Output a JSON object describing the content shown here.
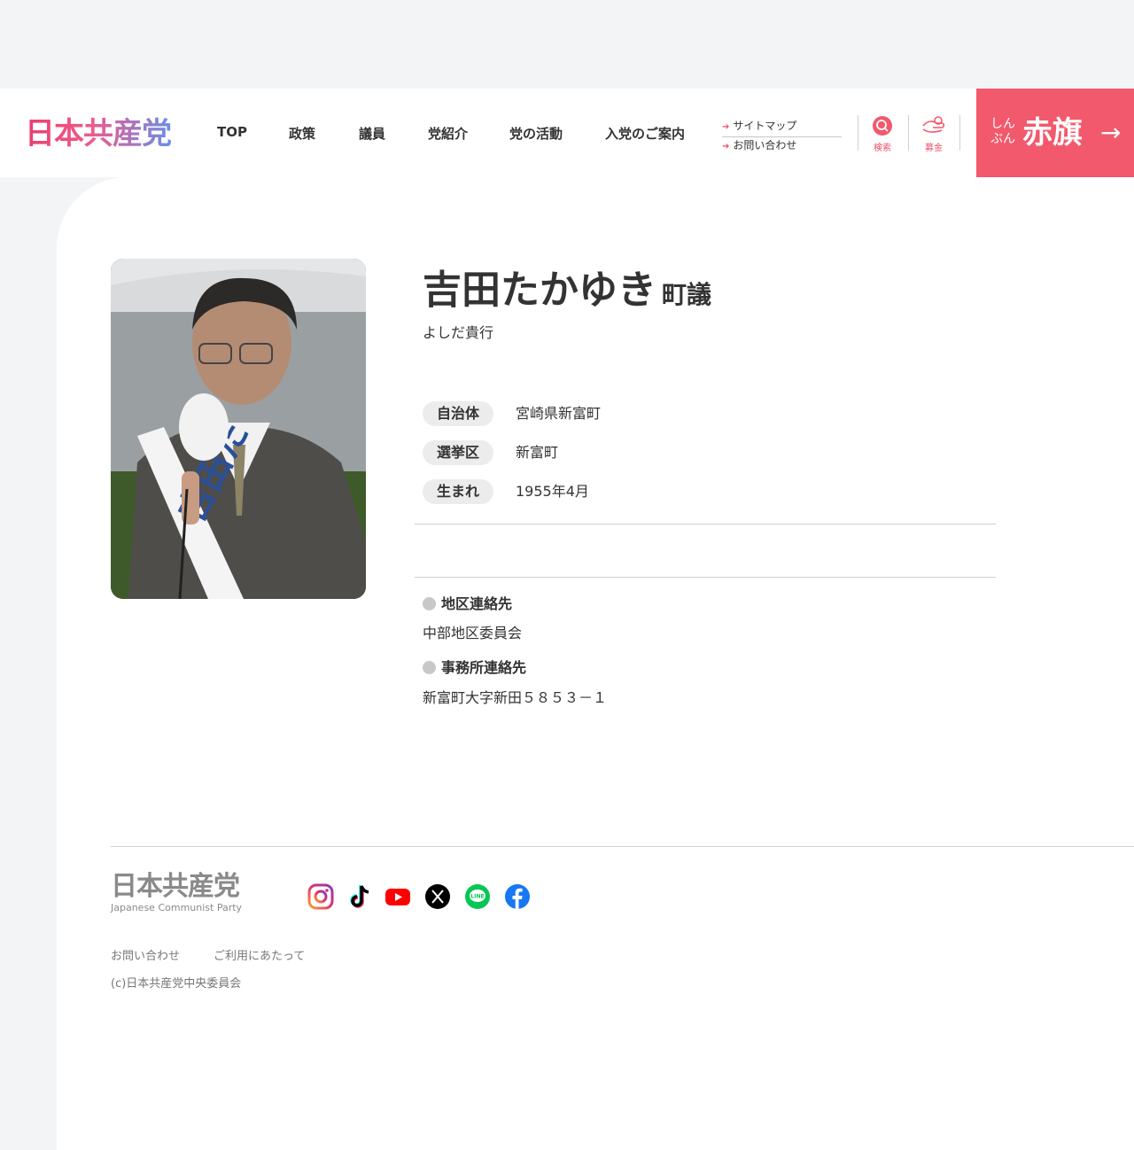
{
  "header": {
    "logo": "日本共産党",
    "nav": [
      "TOP",
      "政策",
      "議員",
      "党紹介",
      "党の活動",
      "入党のご案内"
    ],
    "sublinks": [
      "サイトマップ",
      "お問い合わせ"
    ],
    "search_label": "検索",
    "donate_label": "募金",
    "akahata_small_1": "しん",
    "akahata_small_2": "ぶん",
    "akahata_main": "赤旗"
  },
  "profile": {
    "name": "吉田たかゆき",
    "title": "町議",
    "kana": "よしだ貴行",
    "rows": [
      {
        "label": "自治体",
        "value": "宮崎県新富町"
      },
      {
        "label": "選挙区",
        "value": "新富町"
      },
      {
        "label": "生まれ",
        "value": "1955年4月"
      }
    ],
    "contacts": [
      {
        "label": "地区連絡先",
        "value": "中部地区委員会"
      },
      {
        "label": "事務所連絡先",
        "value": "新富町大字新田５８５３－１"
      }
    ],
    "sash_text": "吉田た"
  },
  "footer": {
    "logo": "日本共産党",
    "logo_sub": "Japanese Communist Party",
    "social": [
      "instagram-icon",
      "tiktok-icon",
      "youtube-icon",
      "x-icon",
      "line-icon",
      "facebook-icon"
    ],
    "line_text": "LINE",
    "links": [
      "お問い合わせ",
      "ご利用にあたって"
    ],
    "copyright": "(c)日本共産党中央委員会"
  },
  "colors": {
    "accent": "#f2596c",
    "background": "#f3f4f6"
  }
}
